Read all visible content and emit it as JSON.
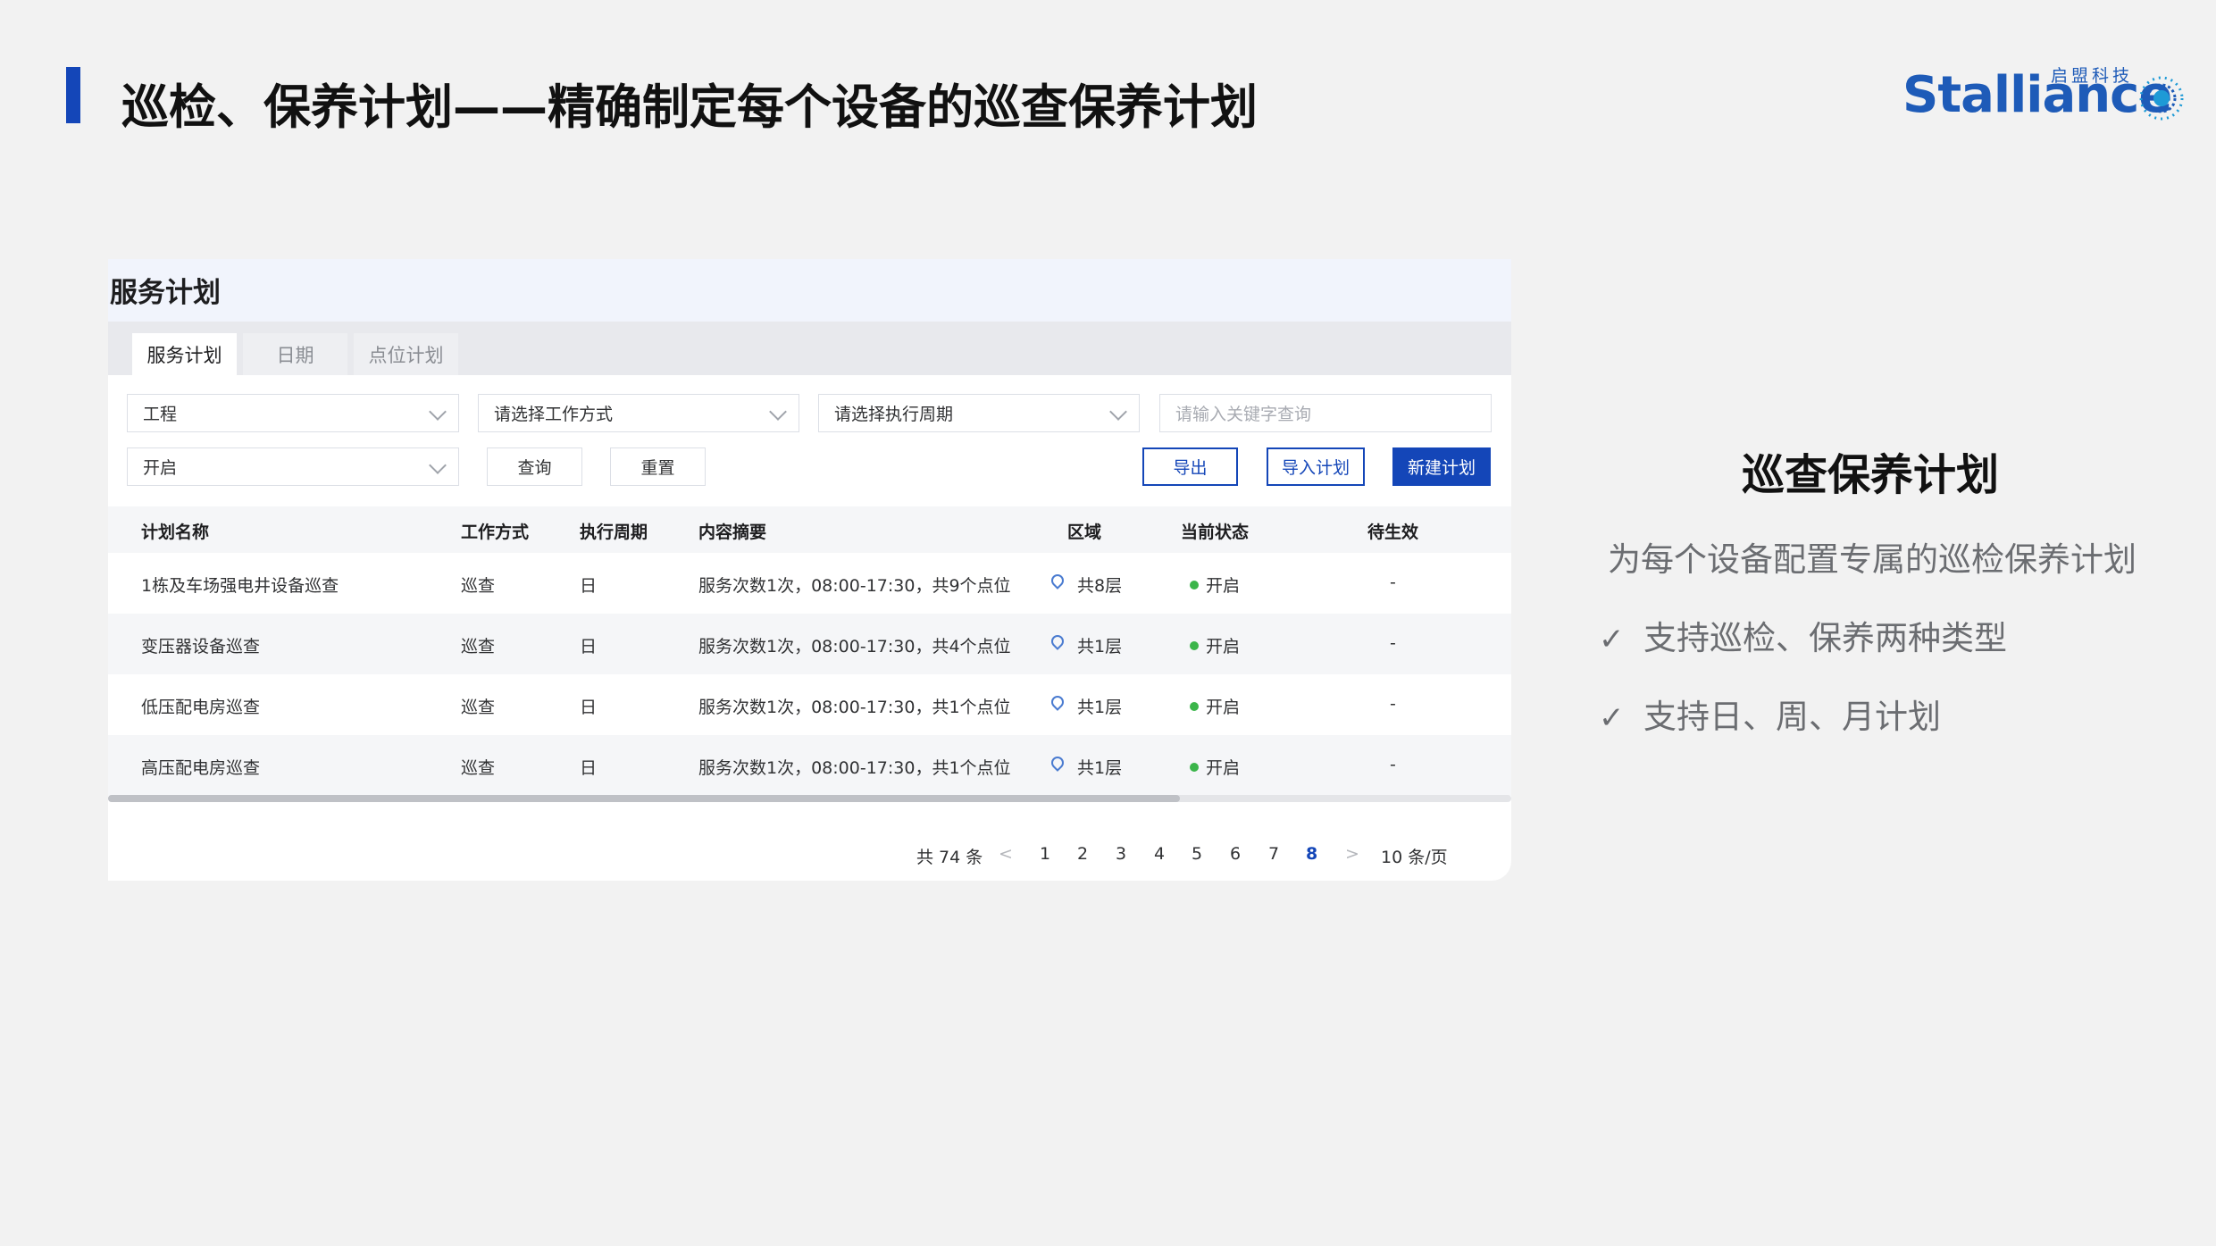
{
  "slide": {
    "title": "巡检、保养计划——精确制定每个设备的巡查保养计划",
    "logo_text": "Stalliance",
    "logo_cn": "启盟科技"
  },
  "panel": {
    "title": "服务计划",
    "tabs": [
      {
        "label": "服务计划",
        "active": true
      },
      {
        "label": "日期",
        "active": false
      },
      {
        "label": "点位计划",
        "active": false
      }
    ],
    "filters": {
      "project": "工程",
      "work_mode": "请选择工作方式",
      "cycle": "请选择执行周期",
      "keyword_placeholder": "请输入关键字查询",
      "status": "开启"
    },
    "buttons": {
      "query": "查询",
      "reset": "重置",
      "export": "导出",
      "import": "导入计划",
      "create": "新建计划"
    },
    "columns": [
      "计划名称",
      "工作方式",
      "执行周期",
      "内容摘要",
      "区域",
      "当前状态",
      "待生效"
    ],
    "rows": [
      {
        "name": "1栋及车场强电井设备巡查",
        "mode": "巡查",
        "cycle": "日",
        "summary": "服务次数1次，08:00-17:30，共9个点位",
        "area": "共8层",
        "status": "开启",
        "pending": "-"
      },
      {
        "name": "变压器设备巡查",
        "mode": "巡查",
        "cycle": "日",
        "summary": "服务次数1次，08:00-17:30，共4个点位",
        "area": "共1层",
        "status": "开启",
        "pending": "-"
      },
      {
        "name": "低压配电房巡查",
        "mode": "巡查",
        "cycle": "日",
        "summary": "服务次数1次，08:00-17:30，共1个点位",
        "area": "共1层",
        "status": "开启",
        "pending": "-"
      },
      {
        "name": "高压配电房巡查",
        "mode": "巡查",
        "cycle": "日",
        "summary": "服务次数1次，08:00-17:30，共1个点位",
        "area": "共1层",
        "status": "开启",
        "pending": "-"
      }
    ],
    "pagination": {
      "total": "共 74 条",
      "prev": "<",
      "pages": [
        "1",
        "2",
        "3",
        "4",
        "5",
        "6",
        "7",
        "8"
      ],
      "current": "8",
      "next": ">",
      "page_size": "10 条/页"
    },
    "status_color": "#3bb54a",
    "accent_color": "#1446b8"
  },
  "side": {
    "title": "巡查保养计划",
    "subtitle": "为每个设备配置专属的巡检保养计划",
    "check_icon": "✓",
    "bullets": [
      "支持巡检、保养两种类型",
      "支持日、周、月计划"
    ]
  }
}
